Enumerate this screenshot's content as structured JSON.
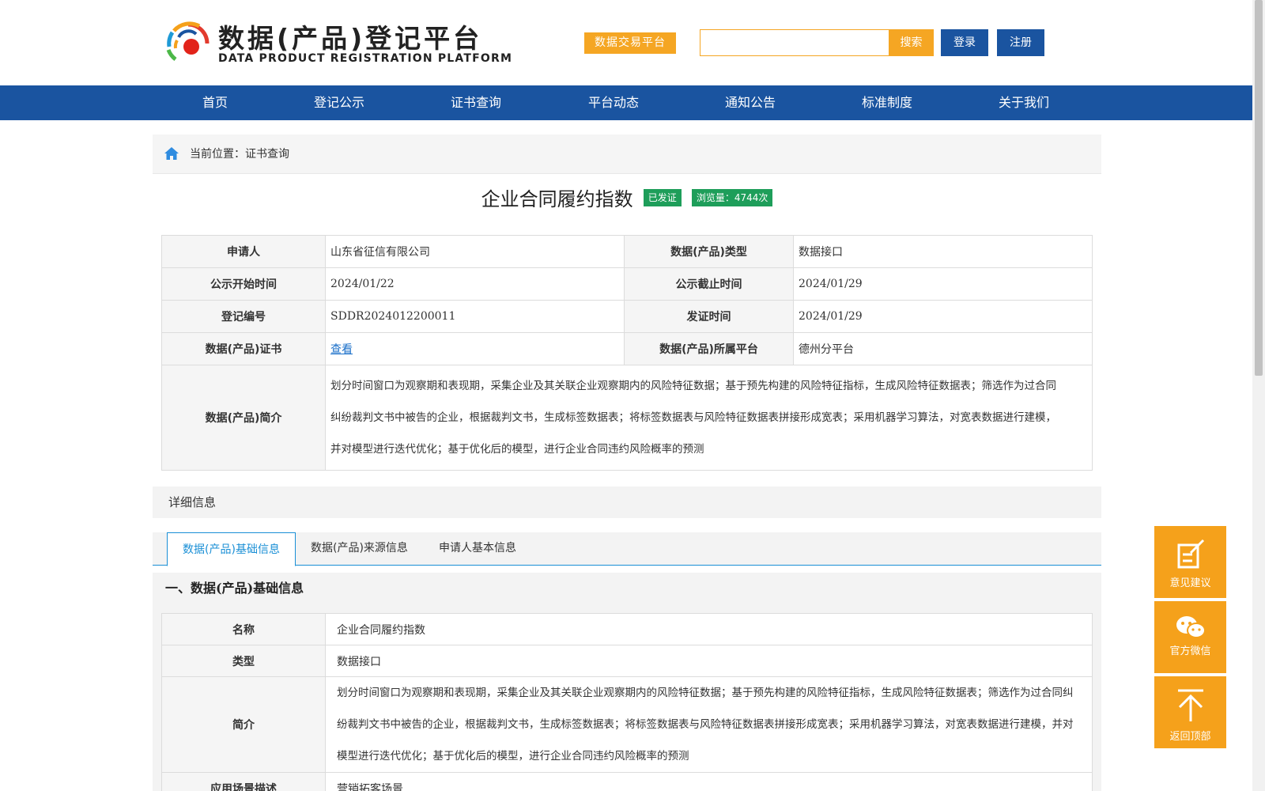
{
  "header": {
    "logo_cn": "数据(产品)登记平台",
    "logo_en": "DATA PRODUCT REGISTRATION PLATFORM",
    "trade_button": "数据交易平台",
    "search_placeholder": "",
    "search_button": "搜索",
    "login_button": "登录",
    "register_button": "注册"
  },
  "nav": {
    "items": [
      {
        "label": "首页"
      },
      {
        "label": "登记公示"
      },
      {
        "label": "证书查询"
      },
      {
        "label": "平台动态"
      },
      {
        "label": "通知公告"
      },
      {
        "label": "标准制度"
      },
      {
        "label": "关于我们"
      }
    ]
  },
  "breadcrumb": {
    "text": "当前位置：证书查询"
  },
  "product": {
    "title": "企业合同履约指数",
    "status_badge": "已发证",
    "views_badge": "浏览量：4744次"
  },
  "info_table": {
    "applicant_label": "申请人",
    "applicant_value": "山东省征信有限公司",
    "type_label": "数据(产品)类型",
    "type_value": "数据接口",
    "start_label": "公示开始时间",
    "start_value": "2024/01/22",
    "end_label": "公示截止时间",
    "end_value": "2024/01/29",
    "reg_no_label": "登记编号",
    "reg_no_value": "SDDR2024012200011",
    "issue_label": "发证时间",
    "issue_value": "2024/01/29",
    "cert_label": "数据(产品)证书",
    "cert_link": "查看",
    "platform_label": "数据(产品)所属平台",
    "platform_value": "德州分平台",
    "intro_label": "数据(产品)简介",
    "intro_value": "划分时间窗口为观察期和表现期，采集企业及其关联企业观察期内的风险特征数据；基于预先构建的风险特征指标，生成风险特征数据表；筛选作为过合同纠纷裁判文书中被告的企业，根据裁判文书，生成标签数据表；将标签数据表与风险特征数据表拼接形成宽表；采用机器学习算法，对宽表数据进行建模，并对模型进行迭代优化；基于优化后的模型，进行企业合同违约风险概率的预测"
  },
  "detail": {
    "heading": "详细信息",
    "tabs": [
      {
        "label": "数据(产品)基础信息"
      },
      {
        "label": "数据(产品)来源信息"
      },
      {
        "label": "申请人基本信息"
      }
    ],
    "section_title": "一、数据(产品)基础信息",
    "rows": {
      "name_label": "名称",
      "name_value": "企业合同履约指数",
      "type_label": "类型",
      "type_value": "数据接口",
      "intro_label": "简介",
      "intro_value": "划分时间窗口为观察期和表现期，采集企业及其关联企业观察期内的风险特征数据；基于预先构建的风险特征指标，生成风险特征数据表；筛选作为过合同纠纷裁判文书中被告的企业，根据裁判文书，生成标签数据表；将标签数据表与风险特征数据表拼接形成宽表；采用机器学习算法，对宽表数据进行建模，并对模型进行迭代优化；基于优化后的模型，进行企业合同违约风险概率的预测",
      "scene_label": "应用场景描述",
      "scene_value": "营销拓客场景"
    }
  },
  "side_buttons": {
    "feedback": "意见建议",
    "wechat": "官方微信",
    "top": "返回顶部"
  },
  "colors": {
    "nav_blue": "#1a54a0",
    "accent_orange": "#f5a623",
    "badge_green": "#1e9e5a",
    "tab_blue": "#1a8fd6"
  }
}
